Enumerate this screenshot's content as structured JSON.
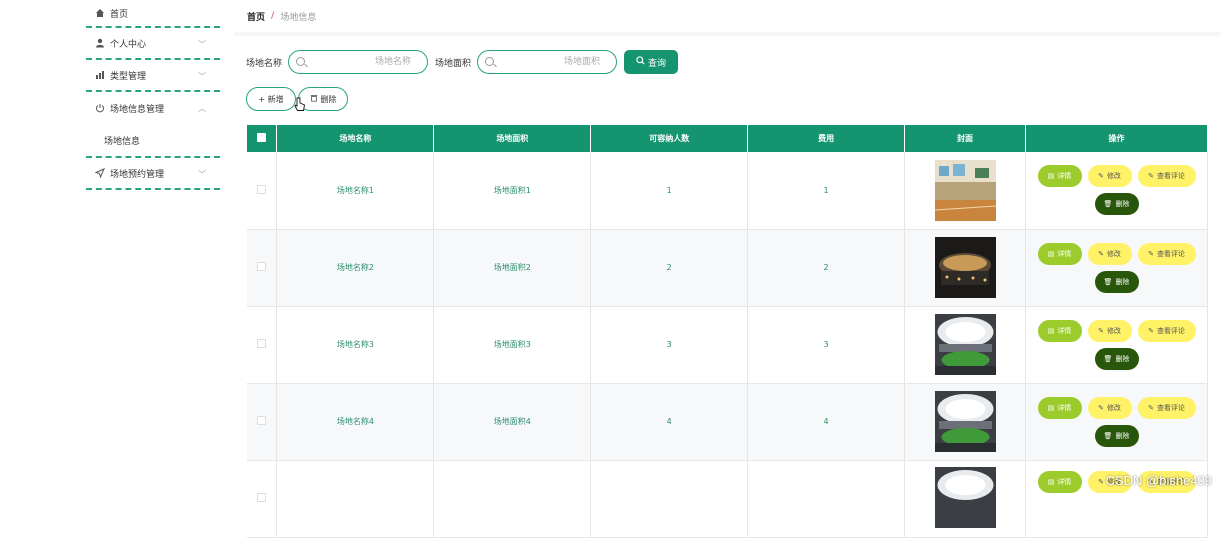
{
  "sidebar": {
    "items": [
      {
        "label": "首页",
        "icon": "home-icon"
      },
      {
        "label": "个人中心",
        "icon": "user-icon"
      },
      {
        "label": "类型管理",
        "icon": "chart-icon"
      },
      {
        "label": "场地信息管理",
        "icon": "power-icon"
      },
      {
        "label": "场地信息"
      },
      {
        "label": "场地预约管理",
        "icon": "send-icon"
      }
    ]
  },
  "breadcrumb": {
    "home": "首页",
    "separator": "/",
    "current": "场地信息"
  },
  "search": {
    "name_label": "场地名称",
    "name_placeholder": "场地名称",
    "area_label": "场地面积",
    "area_placeholder": "场地面积",
    "query_label": "查询"
  },
  "actions": {
    "add_label": "+ 新增",
    "delete_label": "删除"
  },
  "table": {
    "columns": [
      "场地名称",
      "场地面积",
      "可容纳人数",
      "费用",
      "封面",
      "操作"
    ],
    "rows": [
      {
        "name": "场地名称1",
        "area": "场地面积1",
        "capacity": "1",
        "fee": "1",
        "cover": "indoor-gym"
      },
      {
        "name": "场地名称2",
        "area": "场地面积2",
        "capacity": "2",
        "fee": "2",
        "cover": "night-stadium"
      },
      {
        "name": "场地名称3",
        "area": "场地面积3",
        "capacity": "3",
        "fee": "3",
        "cover": "dome-stadium"
      },
      {
        "name": "场地名称4",
        "area": "场地面积4",
        "capacity": "4",
        "fee": "4",
        "cover": "dome-stadium"
      }
    ],
    "ops": {
      "detail": "详情",
      "edit": "修改",
      "review": "查看评论",
      "delete": "删除"
    }
  },
  "watermark": "CSDN @bishe409",
  "colors": {
    "primary": "#14946f",
    "detail": "#9ccc2c",
    "edit": "#fff266",
    "delete": "#28560a"
  }
}
